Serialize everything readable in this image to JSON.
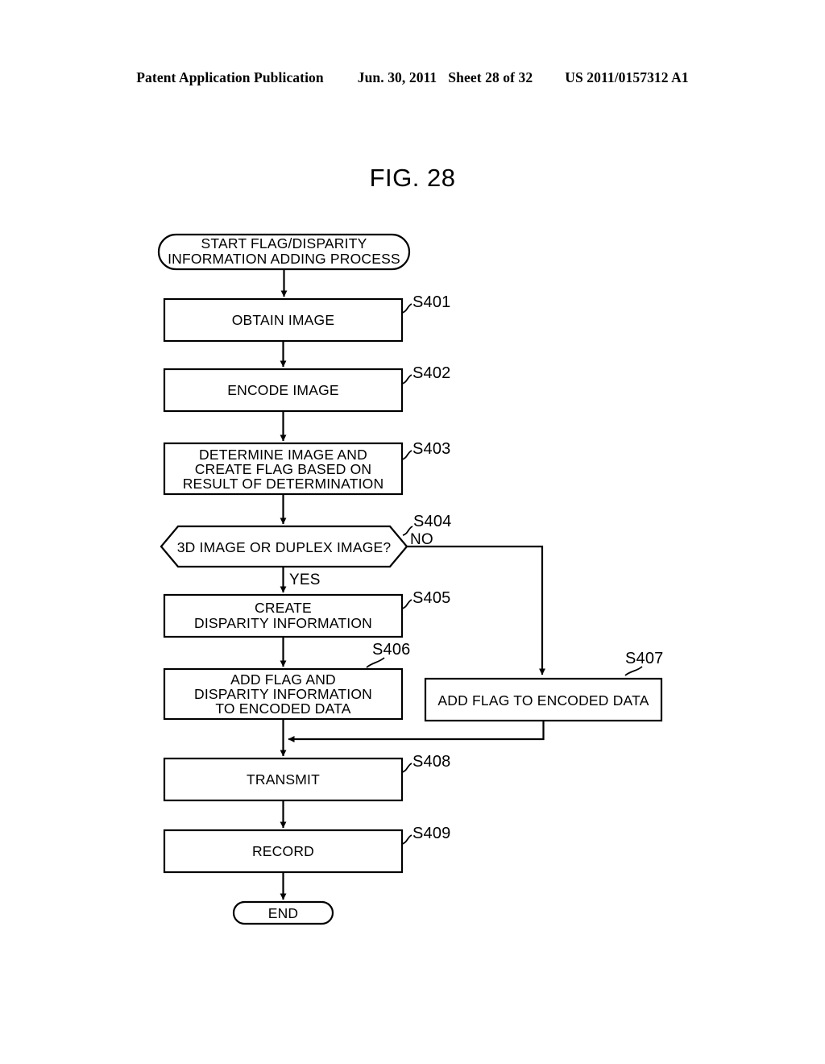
{
  "header": {
    "publication": "Patent Application Publication",
    "date": "Jun. 30, 2011",
    "sheet": "Sheet 28 of 32",
    "document_number": "US 2011/0157312 A1"
  },
  "figure": {
    "title": "FIG. 28"
  },
  "flowchart": {
    "start": {
      "line1": "START FLAG/DISPARITY",
      "line2": "INFORMATION ADDING PROCESS"
    },
    "end": {
      "label": "END"
    },
    "steps": [
      {
        "id": "S401",
        "step": "S401",
        "lines": [
          "OBTAIN IMAGE"
        ]
      },
      {
        "id": "S402",
        "step": "S402",
        "lines": [
          "ENCODE IMAGE"
        ]
      },
      {
        "id": "S403",
        "step": "S403",
        "lines": [
          "DETERMINE IMAGE AND",
          "CREATE FLAG BASED ON",
          "RESULT OF DETERMINATION"
        ]
      },
      {
        "id": "S404",
        "step": "S404",
        "lines": [
          "3D IMAGE OR DUPLEX IMAGE?"
        ],
        "type": "decision",
        "branch_yes": "YES",
        "branch_no": "NO"
      },
      {
        "id": "S405",
        "step": "S405",
        "lines": [
          "CREATE",
          "DISPARITY INFORMATION"
        ]
      },
      {
        "id": "S406",
        "step": "S406",
        "lines": [
          "ADD FLAG AND",
          "DISPARITY INFORMATION",
          "TO ENCODED DATA"
        ]
      },
      {
        "id": "S407",
        "step": "S407",
        "lines": [
          "ADD FLAG TO ENCODED DATA"
        ]
      },
      {
        "id": "S408",
        "step": "S408",
        "lines": [
          "TRANSMIT"
        ]
      },
      {
        "id": "S409",
        "step": "S409",
        "lines": [
          "RECORD"
        ]
      }
    ]
  },
  "colors": {
    "ink": "#000000",
    "paper": "#ffffff"
  }
}
